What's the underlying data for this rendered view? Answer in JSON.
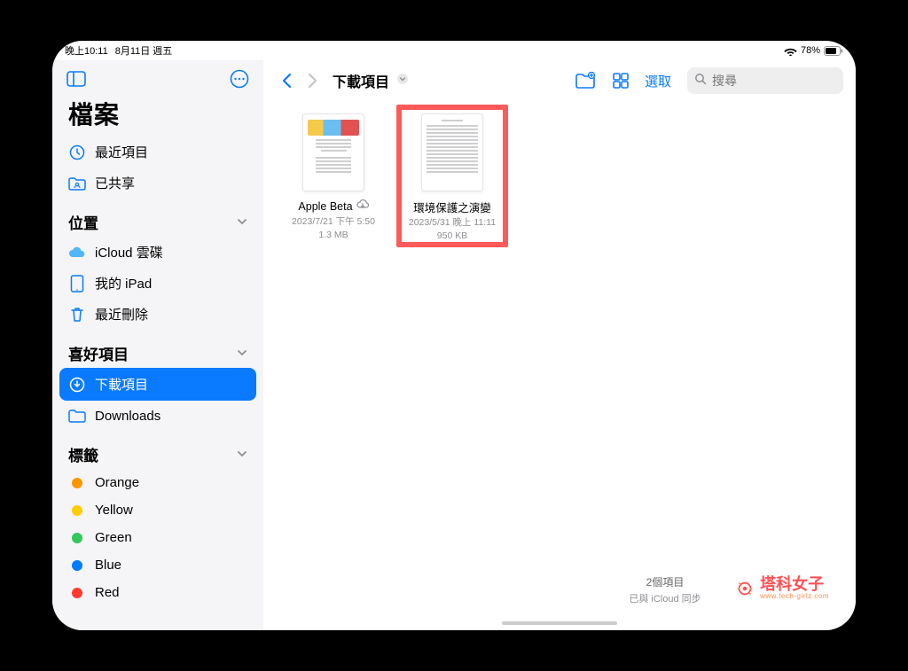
{
  "status": {
    "time": "晚上10:11",
    "date": "8月11日 週五",
    "battery": "78%"
  },
  "sidebar": {
    "title": "檔案",
    "items": {
      "recent": "最近項目",
      "shared": "已共享"
    },
    "locations": {
      "header": "位置",
      "icloud": "iCloud 雲碟",
      "ipad": "我的 iPad",
      "trash": "最近刪除"
    },
    "favorites": {
      "header": "喜好項目",
      "downloads_zh": "下載項目",
      "downloads_en": "Downloads"
    },
    "tags": {
      "header": "標籤",
      "orange": "Orange",
      "yellow": "Yellow",
      "green": "Green",
      "blue": "Blue",
      "red": "Red"
    }
  },
  "toolbar": {
    "title": "下載項目",
    "select": "選取",
    "search_placeholder": "搜尋"
  },
  "files": [
    {
      "name": "Apple Beta",
      "date": "2023/7/21 下午 5:50",
      "size": "1.3 MB",
      "cloud": true
    },
    {
      "name": "環境保護之演變",
      "date": "2023/5/31 晚上 11:11",
      "size": "950 KB",
      "cloud": false,
      "highlighted": true
    }
  ],
  "footer": {
    "count": "2個項目",
    "sync": "已與 iCloud 同步"
  },
  "watermark": {
    "name": "塔科女子",
    "url": "www.tech-girlz.com"
  }
}
